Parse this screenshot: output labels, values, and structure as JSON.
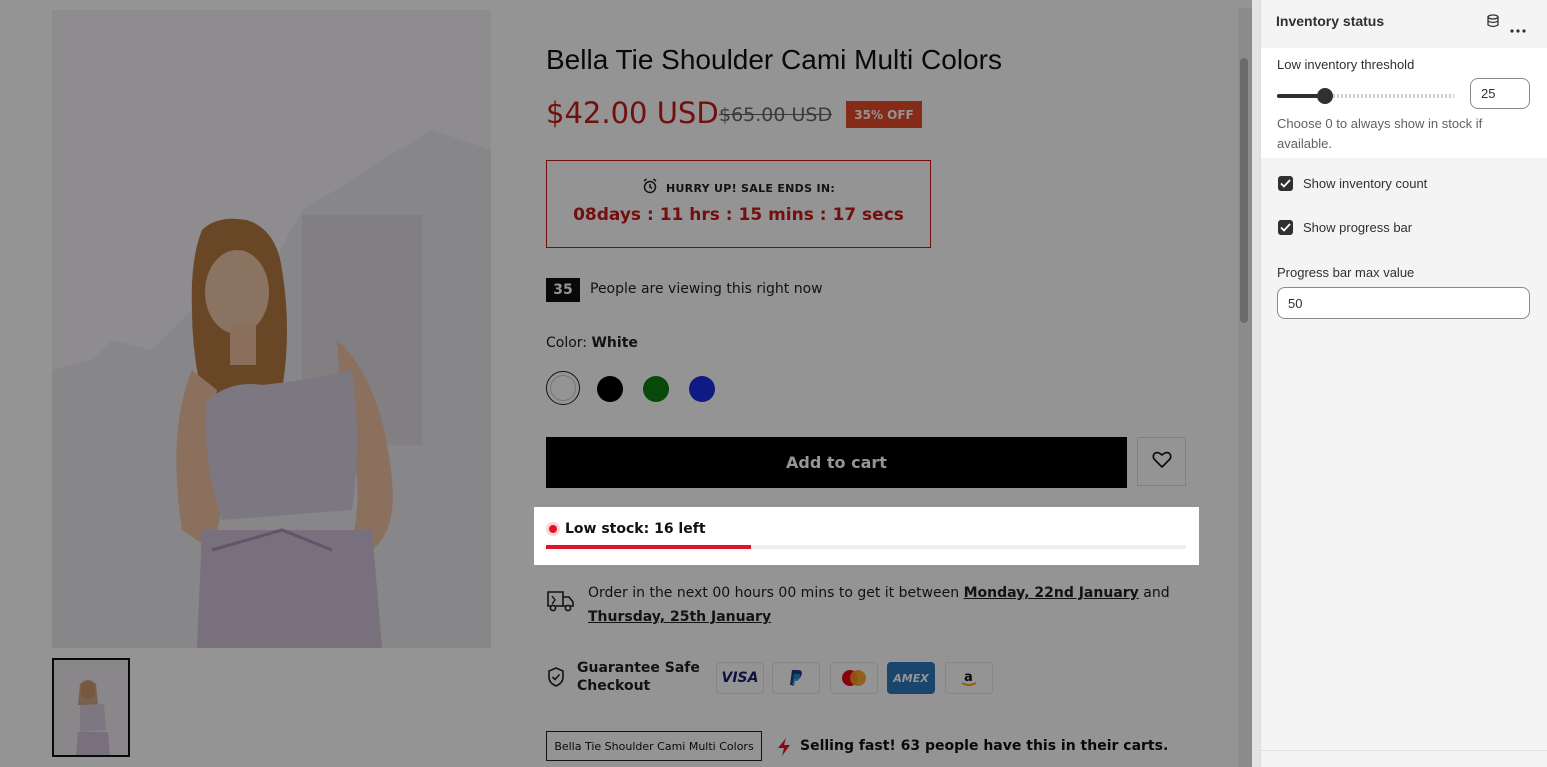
{
  "product": {
    "title": "Bella Tie Shoulder Cami Multi Colors",
    "price": "$42.00 USD",
    "compare_price": "$65.00 USD",
    "discount_badge": "35% OFF"
  },
  "countdown": {
    "label": "HURRY UP! SALE ENDS IN:",
    "value": "08days :  11 hrs : 15 mins :  17 secs"
  },
  "viewers": {
    "count": "35",
    "text": "People are viewing this right now"
  },
  "color": {
    "label": "Color:",
    "selected": "White",
    "swatches": [
      {
        "name": "White",
        "color": "#ffffff"
      },
      {
        "name": "Black",
        "color": "#000000"
      },
      {
        "name": "Green",
        "color": "#0f7d0f"
      },
      {
        "name": "Blue",
        "color": "#1b2ee6"
      }
    ]
  },
  "cart": {
    "add_to_cart": "Add to cart"
  },
  "stock": {
    "label": "Low stock: 16 left",
    "progress_fraction": 0.32,
    "color": "#e2122a"
  },
  "delivery": {
    "prefix": "Order in the next 00 hours 00 mins to get it between",
    "date1": "Monday, 22nd January",
    "and": "and",
    "date2": "Thursday, 25th January"
  },
  "checkout": {
    "label_line1": "Guarantee Safe",
    "label_line2": "Checkout",
    "payments": [
      "VISA",
      "PayPal",
      "Mastercard",
      "AMEX",
      "Amazon"
    ]
  },
  "sticky": {
    "product_button": "Bella Tie Shoulder Cami Multi Colors",
    "selling_fast": "Selling fast! 63 people have this in their carts."
  },
  "panel": {
    "title": "Inventory status",
    "threshold_label": "Low inventory threshold",
    "threshold_value": "25",
    "threshold_fraction": 0.27,
    "threshold_help": "Choose 0 to always show in stock if available.",
    "show_count_label": "Show inventory count",
    "show_count_checked": true,
    "show_bar_label": "Show progress bar",
    "show_bar_checked": true,
    "max_label": "Progress bar max value",
    "max_value": "50"
  }
}
